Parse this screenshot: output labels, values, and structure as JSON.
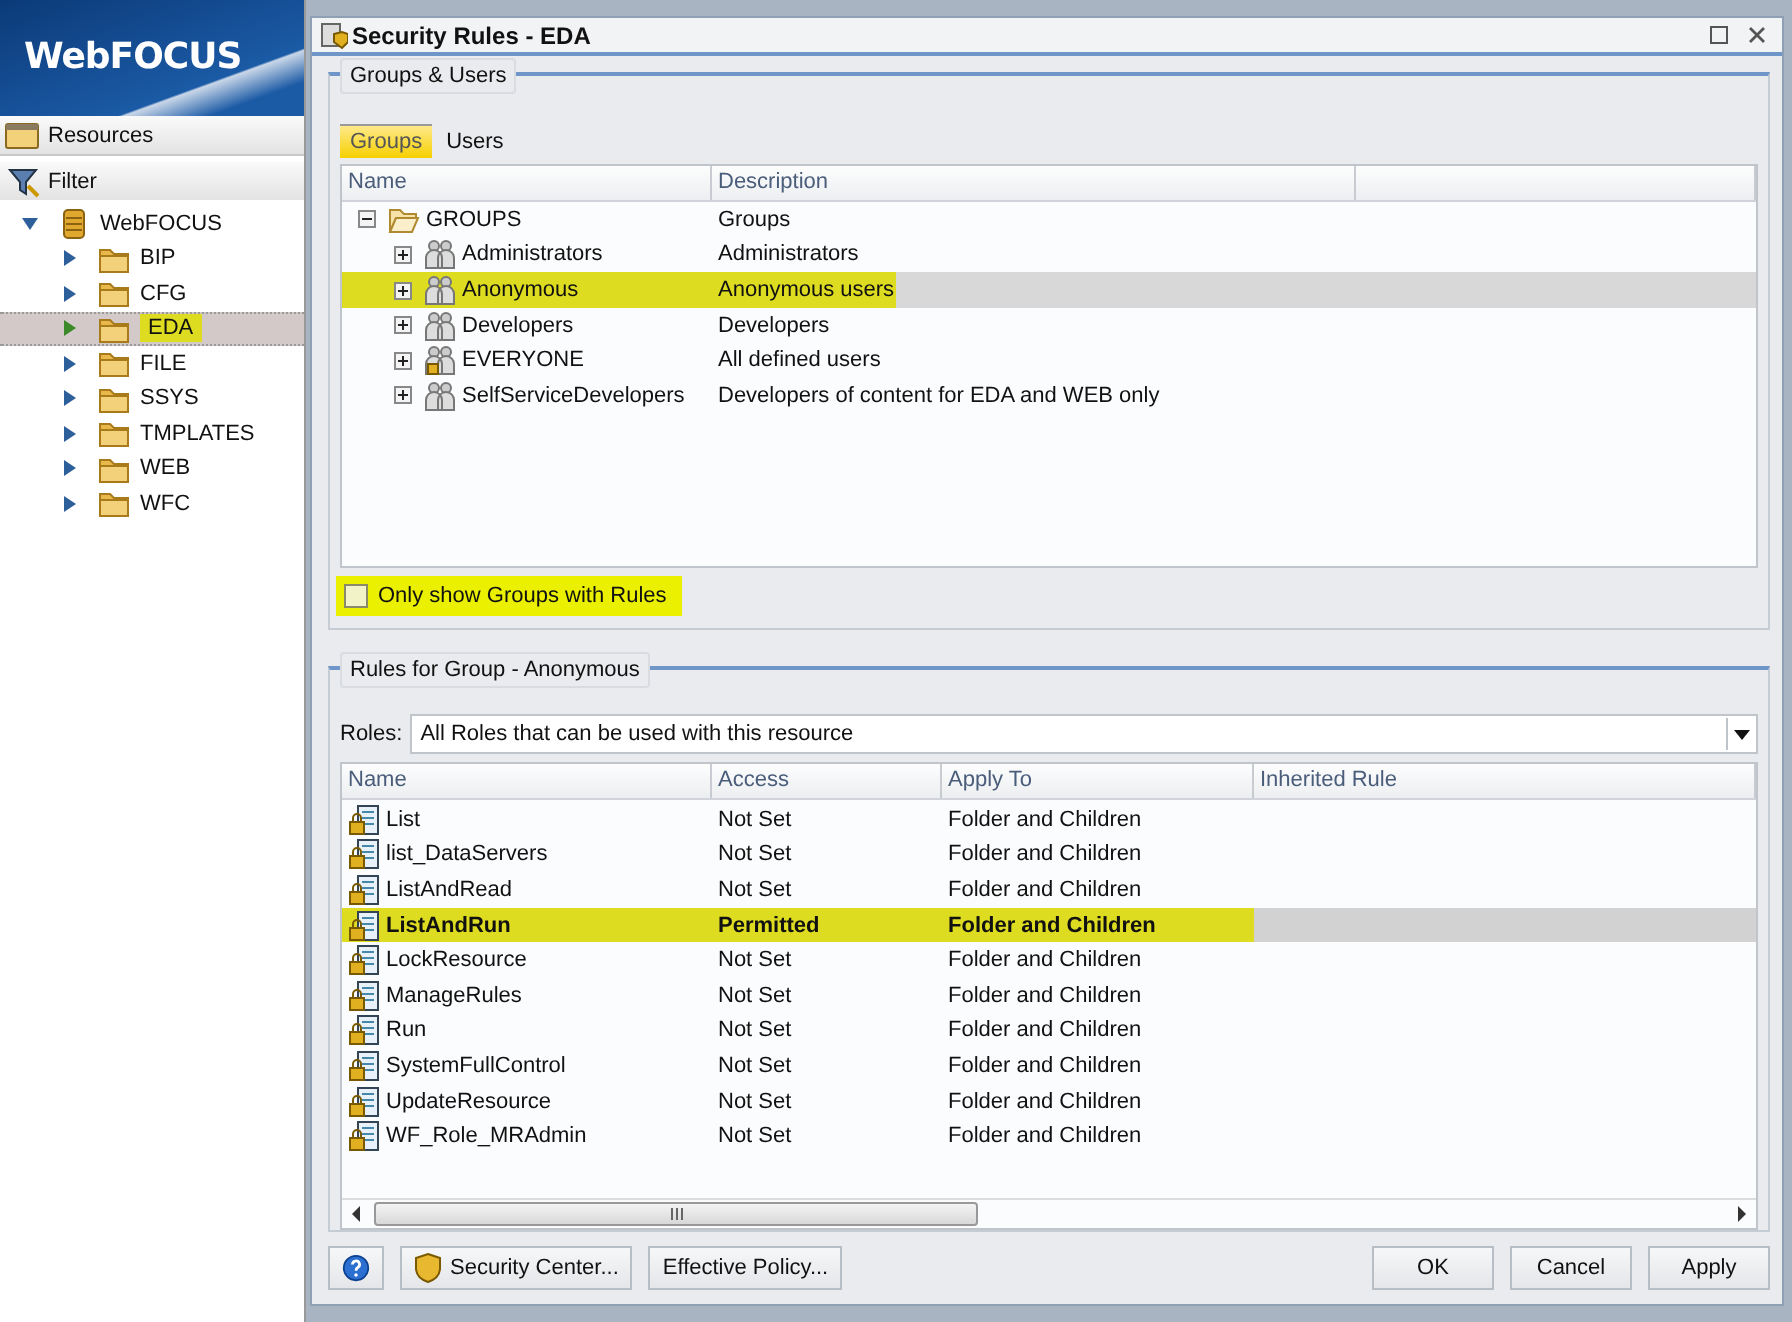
{
  "sidebar": {
    "logo": "WebFOCUS",
    "panel_title": "Resources",
    "filter": "Filter",
    "tree": [
      {
        "label": "WebFOCUS",
        "kind": "server",
        "expanded": true,
        "selected": false,
        "children": [
          {
            "label": "BIP",
            "kind": "folder",
            "expanded": false,
            "selected": false
          },
          {
            "label": "CFG",
            "kind": "folder",
            "expanded": false,
            "selected": false
          },
          {
            "label": "EDA",
            "kind": "folder",
            "expanded": false,
            "selected": true
          },
          {
            "label": "FILE",
            "kind": "folder",
            "expanded": false,
            "selected": false
          },
          {
            "label": "SSYS",
            "kind": "folder",
            "expanded": false,
            "selected": false
          },
          {
            "label": "TMPLATES",
            "kind": "folder",
            "expanded": false,
            "selected": false
          },
          {
            "label": "WEB",
            "kind": "folder",
            "expanded": false,
            "selected": false
          },
          {
            "label": "WFC",
            "kind": "folder",
            "expanded": false,
            "selected": false
          }
        ]
      }
    ]
  },
  "dialog": {
    "title": "Security Rules - EDA",
    "groups_users": {
      "legend": "Groups & Users",
      "tabs": [
        {
          "label": "Groups",
          "selected": true
        },
        {
          "label": "Users",
          "selected": false
        }
      ],
      "columns": [
        "Name",
        "Description"
      ],
      "tree": [
        {
          "name": "GROUPS",
          "description": "Groups",
          "kind": "folder",
          "expanded": true,
          "selected": false,
          "children": [
            {
              "name": "Administrators",
              "description": "Administrators",
              "kind": "group",
              "expanded": false,
              "selected": false
            },
            {
              "name": "Anonymous",
              "description": "Anonymous users",
              "kind": "group",
              "expanded": false,
              "selected": true
            },
            {
              "name": "Developers",
              "description": "Developers",
              "kind": "group",
              "expanded": false,
              "selected": false
            },
            {
              "name": "EVERYONE",
              "description": "All defined users",
              "kind": "locked-group",
              "expanded": false,
              "selected": false
            },
            {
              "name": "SelfServiceDevelopers",
              "description": "Developers of content for EDA and WEB only",
              "kind": "group",
              "expanded": false,
              "selected": false
            }
          ]
        }
      ],
      "filter_checkbox": {
        "label": "Only show Groups with Rules",
        "checked": false
      }
    },
    "rules": {
      "legend": "Rules for Group - Anonymous",
      "roles_label": "Roles:",
      "roles_value": "All Roles that can be used with this resource",
      "columns": [
        "Name",
        "Access",
        "Apply To",
        "Inherited Rule"
      ],
      "rows": [
        {
          "name": "List",
          "access": "Not Set",
          "apply_to": "Folder and Children",
          "selected": false
        },
        {
          "name": "list_DataServers",
          "access": "Not Set",
          "apply_to": "Folder and Children",
          "selected": false
        },
        {
          "name": "ListAndRead",
          "access": "Not Set",
          "apply_to": "Folder and Children",
          "selected": false
        },
        {
          "name": "ListAndRun",
          "access": "Permitted",
          "apply_to": "Folder and Children",
          "selected": true
        },
        {
          "name": "LockResource",
          "access": "Not Set",
          "apply_to": "Folder and Children",
          "selected": false
        },
        {
          "name": "ManageRules",
          "access": "Not Set",
          "apply_to": "Folder and Children",
          "selected": false
        },
        {
          "name": "Run",
          "access": "Not Set",
          "apply_to": "Folder and Children",
          "selected": false
        },
        {
          "name": "SystemFullControl",
          "access": "Not Set",
          "apply_to": "Folder and Children",
          "selected": false
        },
        {
          "name": "UpdateResource",
          "access": "Not Set",
          "apply_to": "Folder and Children",
          "selected": false
        },
        {
          "name": "WF_Role_MRAdmin",
          "access": "Not Set",
          "apply_to": "Folder and Children",
          "selected": false
        }
      ]
    },
    "buttons": [
      {
        "label": "Security Center...",
        "kind": "shield"
      },
      {
        "label": "Effective Policy...",
        "kind": "plain"
      },
      {
        "label": "OK",
        "kind": "plain"
      },
      {
        "label": "Cancel",
        "kind": "plain"
      },
      {
        "label": "Apply",
        "kind": "plain"
      }
    ]
  }
}
